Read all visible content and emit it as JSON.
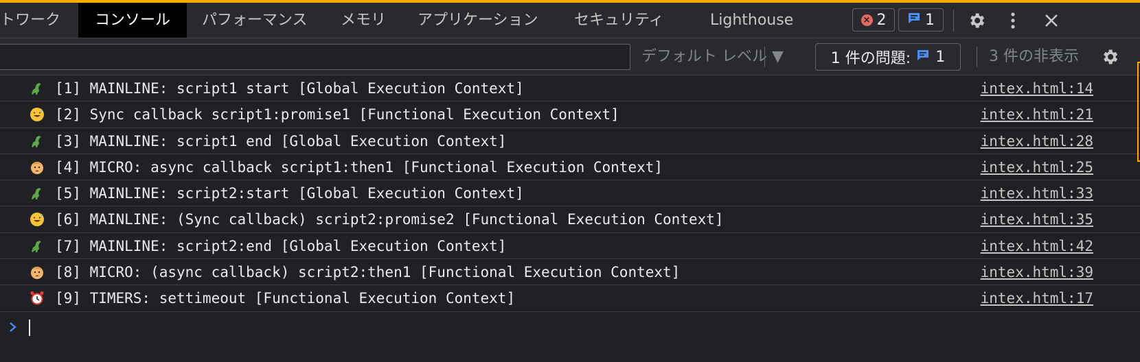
{
  "tabs": [
    {
      "label": "トワーク",
      "active": false
    },
    {
      "label": "コンソール",
      "active": true
    },
    {
      "label": "パフォーマンス",
      "active": false
    },
    {
      "label": "メモリ",
      "active": false
    },
    {
      "label": "アプリケーション",
      "active": false
    },
    {
      "label": "セキュリティ",
      "active": false
    },
    {
      "label": "Lighthouse",
      "active": false
    }
  ],
  "badges": {
    "errors": "2",
    "messages": "1"
  },
  "filter": {
    "value": "",
    "levels_label": "デフォルト レベル ▼",
    "issues_label": "1 件の問題:",
    "issues_count": "1",
    "hidden_label": "3 件の非表示"
  },
  "console": {
    "rows": [
      {
        "icon": "dinosaur-icon",
        "text": "[1] MAINLINE: script1 start [Global Execution Context]",
        "source": "intex.html:14"
      },
      {
        "icon": "sweat-smile-icon",
        "text": "[2] Sync callback script1:promise1 [Functional Execution Context]",
        "source": "intex.html:21"
      },
      {
        "icon": "dinosaur-icon",
        "text": "[3] MAINLINE: script1 end [Global Execution Context]",
        "source": "intex.html:28"
      },
      {
        "icon": "baby-face-icon",
        "text": "[4] MICRO: async callback script1:then1 [Functional Execution Context]",
        "source": "intex.html:25"
      },
      {
        "icon": "dinosaur-icon",
        "text": "[5] MAINLINE: script2:start [Global Execution Context]",
        "source": "intex.html:33"
      },
      {
        "icon": "sweat-smile-icon",
        "text": "[6] MAINLINE: (Sync callback) script2:promise2 [Functional Execution Context]",
        "source": "intex.html:35"
      },
      {
        "icon": "dinosaur-icon",
        "text": "[7] MAINLINE: script2:end [Global Execution Context]",
        "source": "intex.html:42"
      },
      {
        "icon": "baby-face-icon",
        "text": "[8] MICRO: (async callback) script2:then1 [Functional Execution Context]",
        "source": "intex.html:39"
      },
      {
        "icon": "alarm-clock-icon",
        "text": "[9] TIMERS: settimeout [Functional Execution Context]",
        "source": "intex.html:17"
      }
    ]
  },
  "colors": {
    "background": "#202124",
    "toolbar": "#292a2d",
    "accent_orange": "#f9ab00",
    "error_red": "#e46962",
    "info_blue": "#4c8df6"
  }
}
